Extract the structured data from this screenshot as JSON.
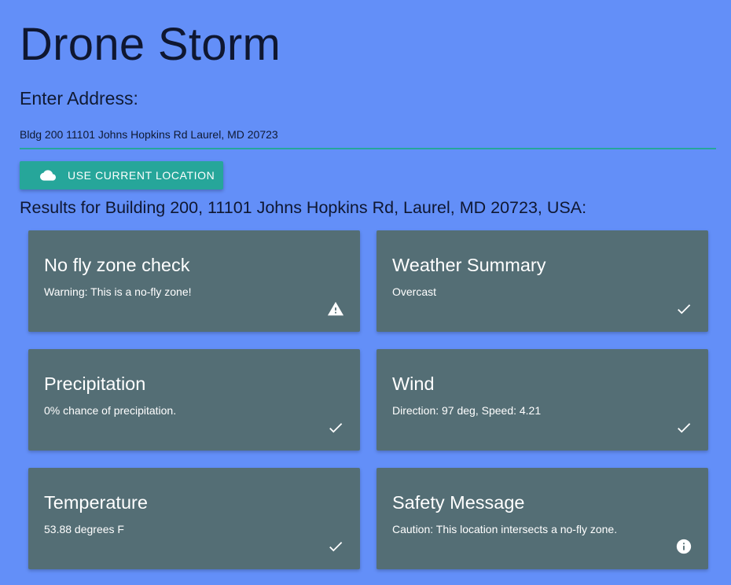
{
  "app": {
    "title": "Drone Storm"
  },
  "address": {
    "label": "Enter Address:",
    "value": "Bldg 200 11101 Johns Hopkins Rd Laurel, MD 20723"
  },
  "location_button": {
    "label": "USE CURRENT LOCATION",
    "icon": "cloud-icon"
  },
  "results": {
    "heading": "Results for Building 200, 11101 Johns Hopkins Rd, Laurel, MD 20723, USA:",
    "cards": [
      {
        "title": "No fly zone check",
        "body": "Warning: This is a no-fly zone!",
        "icon": "warning-icon"
      },
      {
        "title": "Weather Summary",
        "body": "Overcast",
        "icon": "check-icon"
      },
      {
        "title": "Precipitation",
        "body": "0% chance of precipitation.",
        "icon": "check-icon"
      },
      {
        "title": "Wind",
        "body": "Direction: 97 deg, Speed: 4.21",
        "icon": "check-icon"
      },
      {
        "title": "Temperature",
        "body": "53.88 degrees F",
        "icon": "check-icon"
      },
      {
        "title": "Safety Message",
        "body": "Caution: This location intersects a no-fly zone.",
        "icon": "info-icon"
      }
    ]
  },
  "colors": {
    "background": "#638ff8",
    "accent": "#26a69a",
    "card": "#546e75"
  }
}
